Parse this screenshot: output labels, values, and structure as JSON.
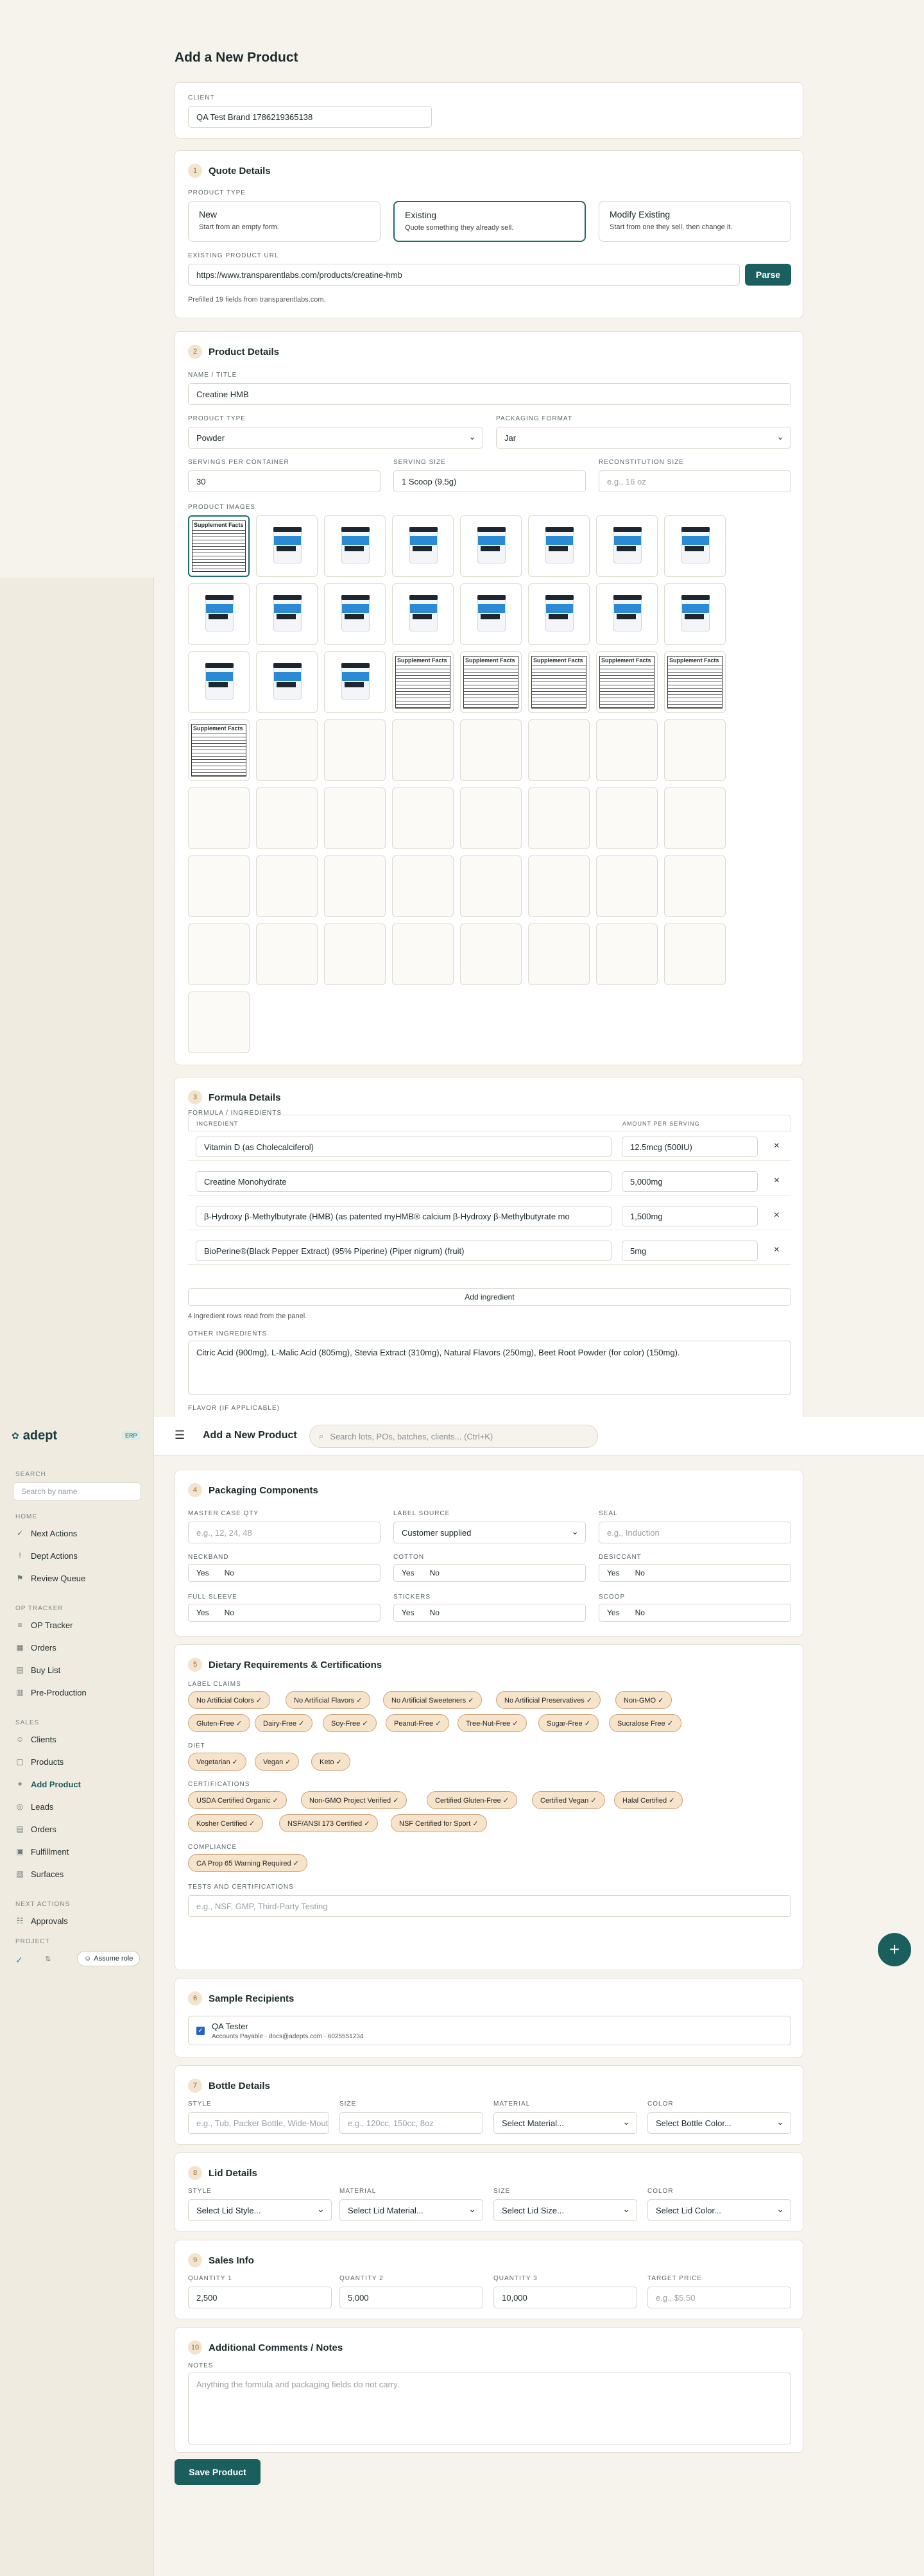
{
  "page": {
    "title": "Add a New Product"
  },
  "client": {
    "label": "CLIENT",
    "value": "QA Test Brand 1786219365138"
  },
  "quote": {
    "num": "1",
    "title": "Quote Details",
    "type_label": "PRODUCT TYPE",
    "types": [
      {
        "name": "New",
        "desc": "Start from an empty form."
      },
      {
        "name": "Existing",
        "desc": "Quote something they already sell."
      },
      {
        "name": "Modify Existing",
        "desc": "Start from one they sell, then change it."
      }
    ],
    "url_label": "EXISTING PRODUCT URL",
    "url_value": "https://www.transparentlabs.com/products/creatine-hmb",
    "parse_label": "Parse",
    "prefill_note": "Prefilled 19 fields from transparentlabs.com."
  },
  "product": {
    "num": "2",
    "title": "Product Details",
    "name_label": "NAME / TITLE",
    "name_value": "Creatine HMB",
    "type_label": "PRODUCT TYPE",
    "type_value": "Powder",
    "pack_label": "PACKAGING FORMAT",
    "pack_value": "Jar",
    "servings_label": "SERVINGS PER CONTAINER",
    "servings_value": "30",
    "size_label": "SERVING SIZE",
    "size_value": "1 Scoop (9.5g)",
    "recon_label": "RECONSTITUTION SIZE",
    "recon_placeholder": "e.g., 16 oz",
    "images_label": "PRODUCT IMAGES",
    "jar_label": "CREATINE HMB",
    "facts_label": "Supplement Facts"
  },
  "formula": {
    "num": "3",
    "title": "Formula Details",
    "list_label": "FORMULA / INGREDIENTS",
    "col_ingredient": "INGREDIENT",
    "col_amount": "AMOUNT PER SERVING",
    "rows": [
      {
        "ingredient": "Vitamin D (as Cholecalciferol)",
        "amount": "12.5mcg (500IU)"
      },
      {
        "ingredient": "Creatine Monohydrate",
        "amount": "5,000mg"
      },
      {
        "ingredient": "β-Hydroxy β-Methylbutyrate (HMB) (as patented myHMB® calcium β-Hydroxy β-Methylbutyrate mo",
        "amount": "1,500mg"
      },
      {
        "ingredient": "BioPerine®(Black Pepper Extract) (95% Piperine) (Piper nigrum) (fruit)",
        "amount": "5mg"
      }
    ],
    "remove_icon": "×",
    "add_label": "Add ingredient",
    "rows_note": "4 ingredient rows read from the panel.",
    "other_label": "OTHER INGREDIENTS",
    "other_value": "Citric Acid (900mg), L-Malic Acid (805mg), Stevia Extract (310mg), Natural Flavors (250mg), Beet Root Powder (for color) (150mg).",
    "flavor_label": "FLAVOR (IF APPLICABLE)"
  },
  "topbar": {
    "title": "Add a New Product",
    "search_placeholder": "Search lots, POs, batches, clients... (Ctrl+K)"
  },
  "nav": {
    "brand": "adept",
    "env": "ERP",
    "search_section": "SEARCH",
    "search_placeholder": "Search by name",
    "sections": [
      {
        "title": "HOME",
        "items": [
          {
            "label": "Next Actions",
            "icon": "check-circle-icon",
            "glyph": "✓"
          },
          {
            "label": "Dept Actions",
            "icon": "alert-icon",
            "glyph": "!"
          },
          {
            "label": "Review Queue",
            "icon": "flag-icon",
            "glyph": "⚑"
          }
        ]
      },
      {
        "title": "OP TRACKER",
        "items": [
          {
            "label": "OP Tracker",
            "icon": "list-icon",
            "glyph": "≡"
          },
          {
            "label": "Orders",
            "icon": "box-icon",
            "glyph": "▦"
          },
          {
            "label": "Buy List",
            "icon": "cart-icon",
            "glyph": "▤"
          },
          {
            "label": "Pre-Production",
            "icon": "grid-icon",
            "glyph": "▥"
          }
        ]
      },
      {
        "title": "SALES",
        "items": [
          {
            "label": "Clients",
            "icon": "users-icon",
            "glyph": "☺"
          },
          {
            "label": "Products",
            "icon": "package-icon",
            "glyph": "▢"
          },
          {
            "label": "Add Product",
            "icon": "plus-icon",
            "glyph": "+"
          },
          {
            "label": "Leads",
            "icon": "target-icon",
            "glyph": "◎"
          },
          {
            "label": "Orders",
            "icon": "doc-icon",
            "glyph": "▤"
          },
          {
            "label": "Fulfillment",
            "icon": "truck-icon",
            "glyph": "▣"
          },
          {
            "label": "Surfaces",
            "icon": "layers-icon",
            "glyph": "▧"
          }
        ]
      },
      {
        "title": "NEXT ACTIONS",
        "items": [
          {
            "label": "Approvals",
            "icon": "approval-icon",
            "glyph": "☷"
          }
        ]
      }
    ],
    "project_section": "PROJECT",
    "assume_label": "Assume role"
  },
  "packaging": {
    "num": "4",
    "title": "Packaging Components",
    "master_label": "MASTER CASE QTY",
    "master_placeholder": "e.g., 12, 24, 48",
    "source_label": "LABEL SOURCE",
    "source_value": "Customer supplied",
    "seal_label": "SEAL",
    "seal_placeholder": "e.g., Induction",
    "neckband_label": "NECKBAND",
    "cotton_label": "COTTON",
    "desiccant_label": "DESICCANT",
    "sleeve_label": "FULL SLEEVE",
    "stickers_label": "STICKERS",
    "scoop_label": "SCOOP",
    "yes": "Yes",
    "no": "No"
  },
  "dietary": {
    "num": "5",
    "title": "Dietary Requirements & Certifications",
    "claims_label": "LABEL CLAIMS",
    "claims": [
      "No Artificial Colors ✓",
      "No Artificial Flavors ✓",
      "No Artificial Sweeteners ✓",
      "No Artificial Preservatives ✓",
      "Non-GMO ✓",
      "Gluten-Free ✓",
      "Dairy-Free ✓",
      "Soy-Free ✓",
      "Peanut-Free ✓",
      "Tree-Nut-Free ✓",
      "Sugar-Free ✓",
      "Sucralose Free ✓"
    ],
    "diet_label": "DIET",
    "diet": [
      "Vegetarian ✓",
      "Vegan ✓",
      "Keto ✓"
    ],
    "cert_label": "CERTIFICATIONS",
    "certs": [
      "USDA Certified Organic ✓",
      "Non-GMO Project Verified ✓",
      "Certified Gluten-Free ✓",
      "Certified Vegan ✓",
      "Halal Certified ✓",
      "Kosher Certified ✓",
      "NSF/ANSI 173 Certified ✓",
      "NSF Certified for Sport ✓"
    ],
    "comp_label": "COMPLIANCE",
    "compliance": [
      "CA Prop 65 Warning Required ✓"
    ],
    "tests_label": "TESTS AND CERTIFICATIONS",
    "tests_placeholder": "e.g., NSF, GMP, Third-Party Testing"
  },
  "samples": {
    "num": "6",
    "title": "Sample Recipients",
    "name": "QA Tester",
    "meta": "Accounts Payable · docs@adepts.com · 6025551234"
  },
  "bottle": {
    "num": "7",
    "title": "Bottle Details",
    "style_label": "STYLE",
    "style_placeholder": "e.g., Tub, Packer Bottle, Wide-Mouth",
    "size_label": "SIZE",
    "size_placeholder": "e.g., 120cc, 150cc, 8oz",
    "material_label": "MATERIAL",
    "material_value": "Select Material...",
    "color_label": "COLOR",
    "color_value": "Select Bottle Color..."
  },
  "lid": {
    "num": "8",
    "title": "Lid Details",
    "style_label": "STYLE",
    "style_value": "Select Lid Style...",
    "material_label": "MATERIAL",
    "material_value": "Select Lid Material...",
    "size_label": "SIZE",
    "size_value": "Select Lid Size...",
    "color_label": "COLOR",
    "color_value": "Select Lid Color..."
  },
  "sales": {
    "num": "9",
    "title": "Sales Info",
    "q1_label": "QUANTITY 1",
    "q1_value": "2,500",
    "q2_label": "QUANTITY 2",
    "q2_value": "5,000",
    "q3_label": "QUANTITY 3",
    "q3_value": "10,000",
    "price_label": "TARGET PRICE",
    "price_placeholder": "e.g., $5.50"
  },
  "comments": {
    "num": "10",
    "title": "Additional Comments / Notes",
    "notes_label": "NOTES",
    "notes_placeholder": "Anything the formula and packaging fields do not carry."
  },
  "save_label": "Save Product",
  "fab_label": "+"
}
